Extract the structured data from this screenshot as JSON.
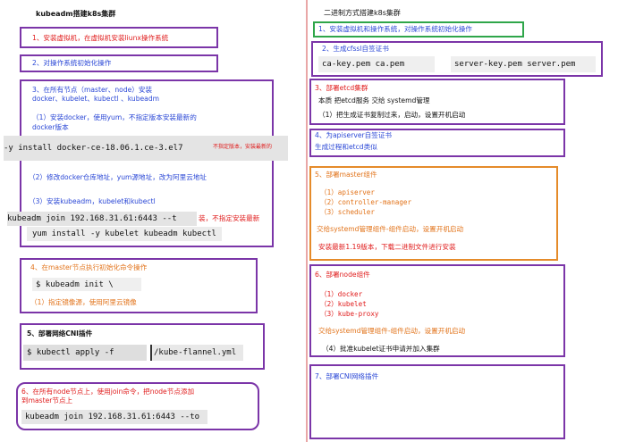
{
  "left": {
    "title": "kubeadm搭建k8s集群",
    "step1": "1、安装虚拟机，在虚拟机安装liunx操作系统",
    "step2": "2、对操作系统初始化操作",
    "step3": {
      "heading1": "3、在所有节点（master、node）安装",
      "heading2": "docker、kubelet、kubectl 、kubeadm",
      "sub1a": "（1）安装docker，使用yum，不指定版本安装最新的",
      "sub1b": "docker版本",
      "code1": "-y install docker-ce-18.06.1.ce-3.el7",
      "code1_note": "不指定版本，安装最新的",
      "sub2": "（2）修改docker仓库地址，yum源地址，改为阿里云地址",
      "sub3": "（3）安装kubeadm，kubelet和kubectl",
      "code2": "kubeadm join 192.168.31.61:6443 --t",
      "code2_note": "装，不指定安装最新",
      "code3": "yum install -y kubelet kubeadm kubectl"
    },
    "step4": {
      "heading": "4、在master节点执行初始化命令操作",
      "code": "$ kubeadm init \\",
      "note": "（1）指定镜像源，使用阿里云镜像"
    },
    "step5": {
      "heading": "5、部署网络CNI插件",
      "code_a": "$ kubectl apply -f",
      "code_b": "/kube-flannel.yml"
    },
    "step6": {
      "heading1": "6、在所有node节点上，使用join命令，把node节点添加",
      "heading2": "到master节点上",
      "code": "kubeadm join 192.168.31.61:6443 --to"
    }
  },
  "right": {
    "title": "二进制方式搭建k8s集群",
    "step1": "1、安装虚拟机和操作系统，对操作系统初始化操作",
    "step2": {
      "heading": "2、生成cfssl自签证书",
      "cert_a": "ca-key.pem  ca.pem",
      "cert_b": "server-key.pem  server.pem"
    },
    "step3": {
      "heading": "3、部署etcd集群",
      "line1": "本质 把etcd服务 交给 systemd管理",
      "line2": "（1）把生成证书复制过来，启动，设置开机启动"
    },
    "step4": {
      "heading": "4、为apiserver自签证书",
      "line": "生成过程和etcd类似"
    },
    "step5": {
      "heading": "5、部署master组件",
      "items": [
        "（1）apiserver",
        "（2）controller-manager",
        "（3）scheduler"
      ],
      "line1": "交给systemd管理组件-组件启动，设置开机启动",
      "line2": "安装最新1.19版本，下载二进制文件进行安装"
    },
    "step6": {
      "heading": "6、部署node组件",
      "items": [
        "（1）docker",
        "（2）kubelet",
        "（3）kube-proxy"
      ],
      "line1": "交给systemd管理组件-组件启动，设置开机启动",
      "line2": "（4）批准kubelet证书申请并加入集群"
    },
    "step7": "7、部署CNI网络插件"
  }
}
